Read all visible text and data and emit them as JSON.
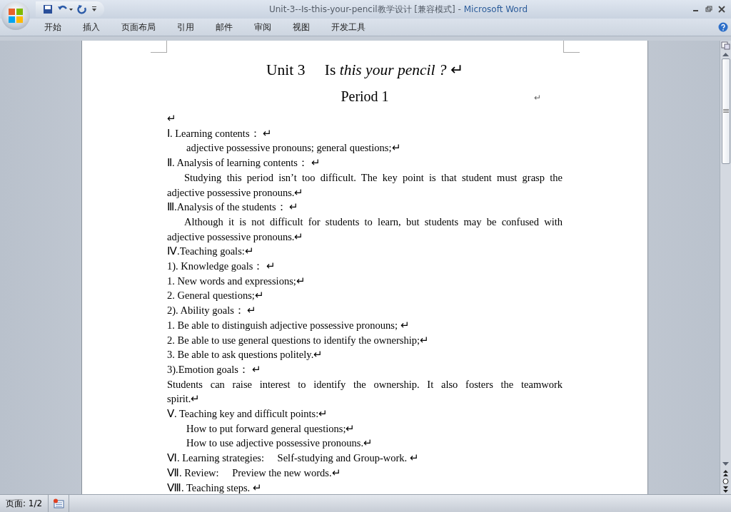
{
  "window": {
    "title": "Unit-3--Is-this-your-pencil教学设计 [兼容模式]",
    "separator": "-",
    "app_name": "Microsoft Word"
  },
  "ribbon_tabs": [
    {
      "label": "开始",
      "selected": false
    },
    {
      "label": "插入",
      "selected": false
    },
    {
      "label": "页面布局",
      "selected": false
    },
    {
      "label": "引用",
      "selected": false
    },
    {
      "label": "邮件",
      "selected": false
    },
    {
      "label": "审阅",
      "selected": false
    },
    {
      "label": "视图",
      "selected": false
    },
    {
      "label": "开发工具",
      "selected": false
    }
  ],
  "document": {
    "lines": [
      {
        "kind": "title",
        "text": "Unit 3　 Is *this your pencil ?* ↵"
      },
      {
        "kind": "subtitle",
        "text": "Period 1",
        "mark": "↵"
      },
      {
        "kind": "line",
        "text": " ↵"
      },
      {
        "kind": "line",
        "text": "Ⅰ. Learning contents： ↵"
      },
      {
        "kind": "indent",
        "text": "adjective possessive pronouns; general questions;↵"
      },
      {
        "kind": "line",
        "text": "Ⅱ. Analysis of learning contents： ↵"
      },
      {
        "kind": "para",
        "text": "Studying this period isn’t too difficult. The key point is that student must grasp the adjective possessive pronouns.↵"
      },
      {
        "kind": "line",
        "text": "Ⅲ.Analysis of the students： ↵"
      },
      {
        "kind": "para",
        "text": "Although it is not difficult for students to learn, but students may be confused with adjective possessive pronouns.↵"
      },
      {
        "kind": "line",
        "text": "Ⅳ.Teaching goals:↵"
      },
      {
        "kind": "line",
        "text": "1). Knowledge goals： ↵"
      },
      {
        "kind": "line",
        "text": "1. New words and expressions;↵"
      },
      {
        "kind": "line",
        "text": "2. General questions;↵"
      },
      {
        "kind": "line",
        "text": "2). Ability goals： ↵"
      },
      {
        "kind": "line",
        "text": "1. Be able to distinguish adjective possessive pronouns; ↵"
      },
      {
        "kind": "line",
        "text": "2. Be able to use general questions to identify the ownership;↵"
      },
      {
        "kind": "line",
        "text": "3. Be able to ask questions politely.↵"
      },
      {
        "kind": "line",
        "text": "3).Emotion goals： ↵"
      },
      {
        "kind": "plain",
        "text": "Students can raise interest to identify the ownership. It also fosters the teamwork spirit.↵"
      },
      {
        "kind": "line",
        "text": "Ⅴ. Teaching key and difficult points:↵"
      },
      {
        "kind": "indent",
        "text": "How to put forward general questions;↵"
      },
      {
        "kind": "indent",
        "text": "How to use adjective possessive pronouns.↵"
      },
      {
        "kind": "line",
        "text": "Ⅵ. Learning strategies:　 Self-studying and Group-work. ↵"
      },
      {
        "kind": "line",
        "text": "Ⅶ. Review:　 Preview the new words.↵"
      },
      {
        "kind": "line",
        "text": "Ⅷ. Teaching steps. ↵"
      }
    ]
  },
  "status_bar": {
    "page": "页面: 1/2"
  }
}
